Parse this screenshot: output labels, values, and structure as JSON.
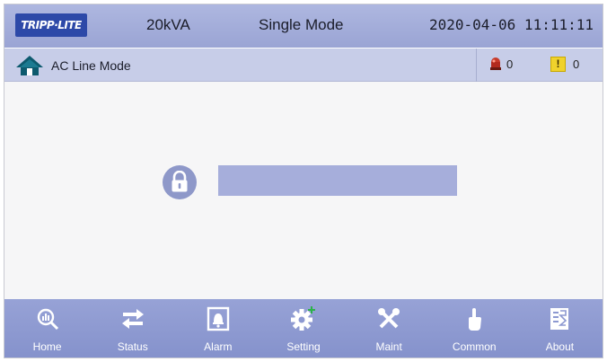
{
  "header": {
    "logo_text": "TRIPP·LITE",
    "model": "20kVA",
    "mode": "Single Mode",
    "datetime": "2020-04-06  11:11:11"
  },
  "subheader": {
    "title": "AC Line Mode",
    "fault_count": "0",
    "warning_count": "0",
    "warning_symbol": "!"
  },
  "main": {
    "password_value": ""
  },
  "nav": {
    "items": [
      {
        "label": "Home",
        "icon": "home-search-icon"
      },
      {
        "label": "Status",
        "icon": "swap-arrows-icon"
      },
      {
        "label": "Alarm",
        "icon": "bell-icon"
      },
      {
        "label": "Setting",
        "icon": "gear-plus-icon"
      },
      {
        "label": "Maint",
        "icon": "tools-icon"
      },
      {
        "label": "Common",
        "icon": "pointer-hand-icon"
      },
      {
        "label": "About",
        "icon": "document-icon"
      }
    ]
  },
  "colors": {
    "header_bg": "#9aa4d4",
    "subheader_bg": "#c7cde8",
    "nav_bg": "#8592cc",
    "field_bg": "#a6aedb",
    "accent_plus": "#2bb34a"
  }
}
